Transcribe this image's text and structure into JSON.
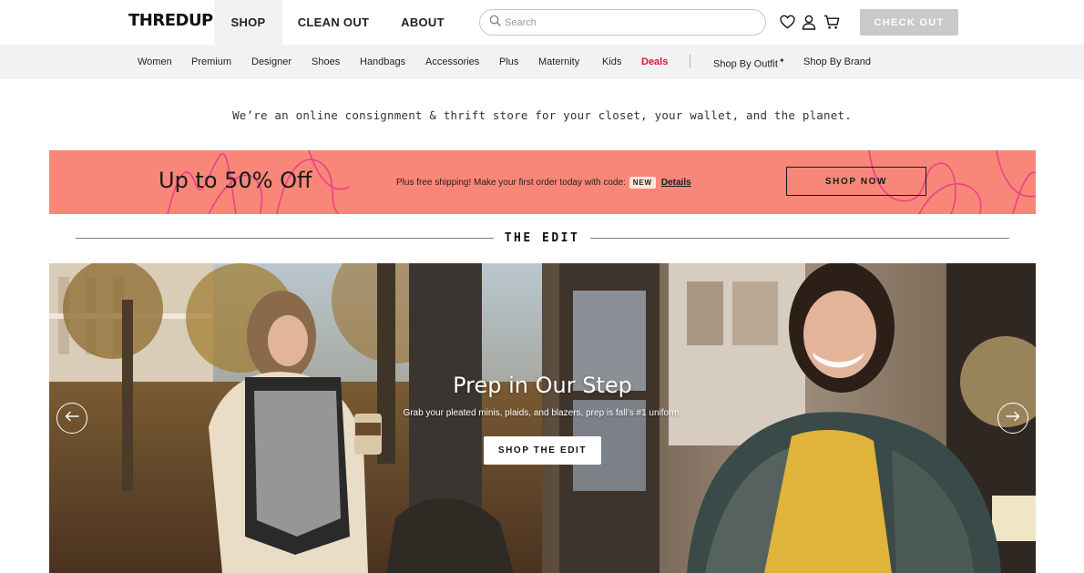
{
  "header": {
    "logo": "THREDUP",
    "tabs": [
      "SHOP",
      "CLEAN OUT",
      "ABOUT"
    ],
    "search_placeholder": "Search",
    "checkout_label": "CHECK OUT"
  },
  "categories": [
    "Women",
    "Premium",
    "Designer",
    "Shoes",
    "Handbags",
    "Accessories",
    "Plus",
    "Maternity",
    "Kids",
    "Deals",
    "Shop By Outfit",
    "Shop By Brand"
  ],
  "tagline": "We’re an online consignment & thrift store for your closet, your wallet, and the planet.",
  "promo": {
    "title": "Up to 50% Off",
    "text": "Plus free shipping! Make your first order today with code:",
    "code": "NEW",
    "details": "Details",
    "button": "SHOP NOW"
  },
  "edit": {
    "heading": "THE EDIT"
  },
  "hero": {
    "title": "Prep in Our Step",
    "subtitle": "Grab your pleated minis, plaids, and blazers, prep is fall’s #1 uniform.",
    "button": "SHOP THE EDIT"
  },
  "colors": {
    "promo_bg": "#f8877a",
    "deals": "#e0143c",
    "checkout_bg": "#c9c9c9",
    "catbar_bg": "#f2f2f2"
  }
}
